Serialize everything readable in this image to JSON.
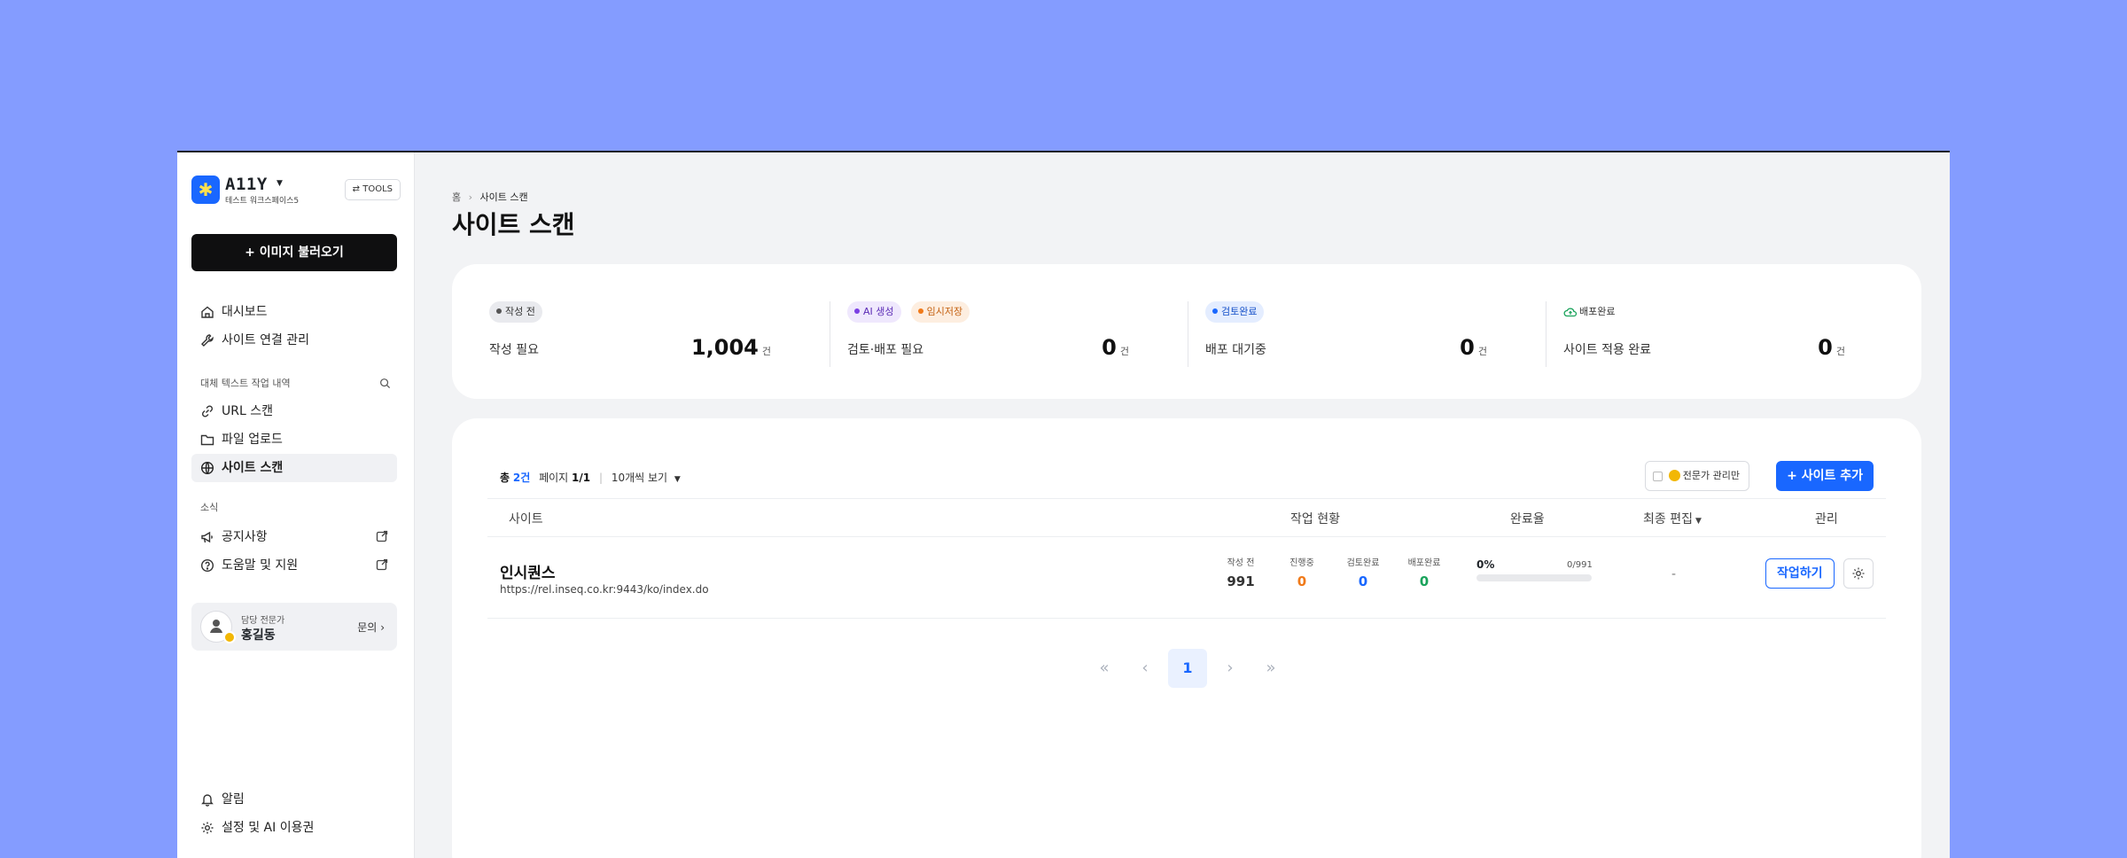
{
  "sidebar": {
    "logo": {
      "name": "A11Y",
      "workspace": "테스트 워크스페이스5"
    },
    "tools_label": "⇄ TOOLS",
    "import_button": "+ 이미지 불러오기",
    "primary_nav": [
      {
        "label": "대시보드",
        "icon": "home-icon"
      },
      {
        "label": "사이트 연결 관리",
        "icon": "wrench-icon"
      }
    ],
    "alt_text_section": "대체 텍스트 작업 내역",
    "alt_text_nav": [
      {
        "label": "URL 스캔",
        "icon": "link-icon"
      },
      {
        "label": "파일 업로드",
        "icon": "folder-icon"
      },
      {
        "label": "사이트 스캔",
        "icon": "globe-icon",
        "active": true
      }
    ],
    "news_section": "소식",
    "news_nav": [
      {
        "label": "공지사항",
        "icon": "megaphone-icon"
      },
      {
        "label": "도움말 및 지원",
        "icon": "help-icon"
      }
    ],
    "manager": {
      "role": "담당 전문가",
      "name": "홍길동",
      "ask": "문의"
    },
    "bottom_nav": [
      {
        "label": "알림",
        "icon": "bell-icon"
      },
      {
        "label": "설정 및 AI 이용권",
        "icon": "gear-icon"
      }
    ]
  },
  "breadcrumb": {
    "home": "홈",
    "current": "사이트 스캔"
  },
  "page_title": "사이트 스캔",
  "stats": [
    {
      "pills": [
        {
          "label": "작성 전",
          "dot": "#555555",
          "bg": "#e9eaee",
          "fg": "#333333"
        }
      ],
      "label": "작성 필요",
      "value": "1,004",
      "unit": "건"
    },
    {
      "pills": [
        {
          "label": "AI 생성",
          "dot": "#7b3fe4",
          "bg": "#efe8fd",
          "fg": "#5b2bb5"
        },
        {
          "label": "임시저장",
          "dot": "#f07a1a",
          "bg": "#fdeee0",
          "fg": "#c4600f"
        }
      ],
      "label": "검토·배포 필요",
      "value": "0",
      "unit": "건"
    },
    {
      "pills": [
        {
          "label": "검토완료",
          "dot": "#1967ff",
          "bg": "#e4edff",
          "fg": "#1550c8"
        }
      ],
      "label": "배포 대기중",
      "value": "0",
      "unit": "건"
    },
    {
      "pills": [
        {
          "label": "배포완료",
          "dot": "#1aa35b",
          "bg": "#ffffff",
          "fg": "#333333"
        }
      ],
      "label": "사이트 적용 완료",
      "value": "0",
      "unit": "건"
    }
  ],
  "list": {
    "total_label": "총",
    "total": "2건",
    "page_label": "페이지",
    "page": "1/1",
    "per_page": "10개씩 보기",
    "expert_only": "전문가 관리만",
    "add_site": "+ 사이트 추가",
    "columns": [
      "사이트",
      "작업 현황",
      "완료율",
      "최종 편집",
      "관리"
    ],
    "rows": [
      {
        "name": "인시퀀스",
        "url": "https://rel.inseq.co.kr:9443/ko/index.do",
        "status": [
          {
            "label": "작성 전",
            "value": "991",
            "color": "#333333"
          },
          {
            "label": "진행중",
            "value": "0",
            "color": "#f07a1a"
          },
          {
            "label": "검토완료",
            "value": "0",
            "color": "#1967ff"
          },
          {
            "label": "배포완료",
            "value": "0",
            "color": "#1aa35b"
          }
        ],
        "percent": "0%",
        "fraction": "0/991",
        "progress": 0,
        "last_edited": "-",
        "action": "작업하기"
      }
    ],
    "pager": {
      "current": "1"
    }
  },
  "colors": {
    "accent": "#1967ff",
    "background": "#849cff"
  }
}
